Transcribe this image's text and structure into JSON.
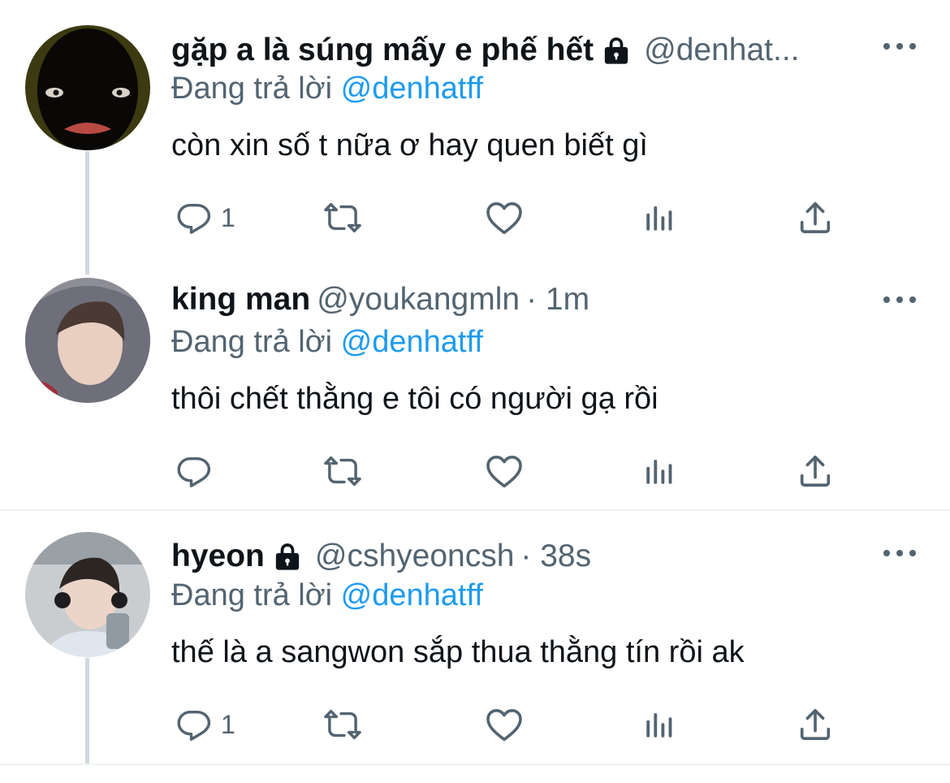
{
  "tweets": [
    {
      "name": "gặp a là súng mấy e phế hết",
      "handle": "@denhat...",
      "time": "",
      "replying_prefix": "Đang trả lời",
      "replying_to": "@denhatff",
      "content": "còn xin số t nữa ơ hay quen biết gì",
      "reply_count": "1",
      "protected": true,
      "avatar_icon": "dark-face-avatar"
    },
    {
      "name": "king man",
      "handle": "@youkangmln",
      "time": "· 1m",
      "replying_prefix": "Đang trả lời",
      "replying_to": "@denhatff",
      "content": "thôi chết thằng e tôi có người gạ rồi",
      "reply_count": "",
      "protected": false,
      "avatar_icon": "hooded-person-avatar"
    },
    {
      "name": "hyeon",
      "handle": "@cshyeoncsh",
      "time": "· 38s",
      "replying_prefix": "Đang trả lời",
      "replying_to": "@denhatff",
      "content": "thế là a sangwon sắp thua thằng tín rồi ak",
      "reply_count": "1",
      "protected": true,
      "avatar_icon": "person-with-headphones-avatar"
    }
  ],
  "colors": {
    "text": "#0f1419",
    "secondary": "#536471",
    "link": "#1d9bf0",
    "thread_line": "#cfd9de",
    "divider": "#eff3f4"
  },
  "icons": [
    "reply-icon",
    "retweet-icon",
    "like-icon",
    "analytics-icon",
    "share-icon",
    "lock-icon",
    "more-icon"
  ]
}
